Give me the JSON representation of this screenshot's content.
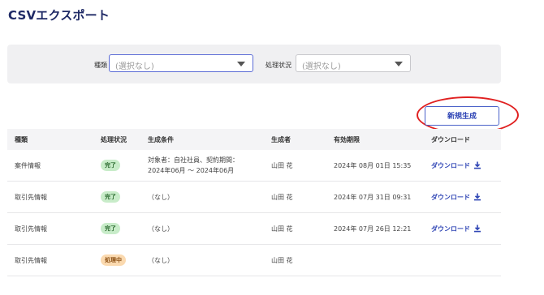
{
  "page": {
    "title": "CSVエクスポート"
  },
  "filters": {
    "type_label": "種類",
    "type_value": "(選択なし)",
    "status_label": "処理状況",
    "status_value": "(選択なし)"
  },
  "actions": {
    "new_label": "新規生成"
  },
  "table": {
    "headers": {
      "type": "種類",
      "status": "処理状況",
      "condition": "生成条件",
      "creator": "生成者",
      "expiry": "有効期限",
      "download": "ダウンロード"
    },
    "rows": [
      {
        "type": "案件情報",
        "status": "完了",
        "condition_line1": "対象者：自社社員、契約期間：",
        "condition_line2": "2024年06月 ～ 2024年06月",
        "creator": "山田 花",
        "expiry": "2024年 08月 01日 15:35",
        "download": "ダウンロード"
      },
      {
        "type": "取引先情報",
        "status": "完了",
        "condition_line1": "（なし）",
        "condition_line2": "",
        "creator": "山田 花",
        "expiry": "2024年 07月 31日 09:31",
        "download": "ダウンロード"
      },
      {
        "type": "取引先情報",
        "status": "完了",
        "condition_line1": "（なし）",
        "condition_line2": "",
        "creator": "山田 花",
        "expiry": "2024年 07月 26日 12:21",
        "download": "ダウンロード"
      },
      {
        "type": "取引先情報",
        "status": "処理中",
        "condition_line1": "（なし）",
        "condition_line2": "",
        "creator": "山田 花",
        "expiry": "",
        "download": ""
      }
    ]
  },
  "colors": {
    "title": "#1f2a66",
    "accent": "#2f45b5",
    "done_badge": "#c8ecc9",
    "processing_badge": "#fbdab0",
    "annotation": "#e02020"
  },
  "icons": {
    "download": "download-icon",
    "dropdown": "caret-down-icon"
  }
}
